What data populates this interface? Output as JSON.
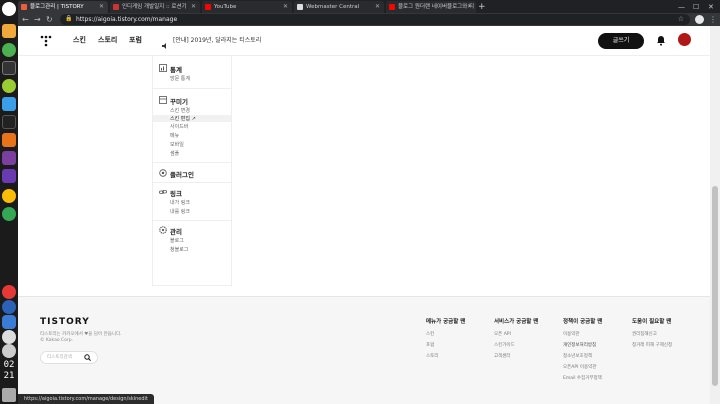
{
  "os": {
    "clock_hour": "02",
    "clock_minute": "21"
  },
  "browser": {
    "tabs": [
      {
        "label": "블로그관리 | TISTORY",
        "favicon_color": "#f25c3a"
      },
      {
        "label": "인디게임 개발일지 :: 로션기",
        "favicon_color": "#cc3333"
      },
      {
        "label": "YouTube",
        "favicon_color": "#ff0000"
      },
      {
        "label": "Webmaster Central",
        "favicon_color": "#dddddd"
      },
      {
        "label": "블로그 원더랜 네이버블로그와 티",
        "favicon_color": "#ff0000"
      }
    ],
    "url": "https://aigoia.tistory.com/manage",
    "status_url": "https://aigoia.tistory.com/manage/design/skinedit"
  },
  "header": {
    "nav": [
      "스킨",
      "스토리",
      "포럼"
    ],
    "notice": "[안내] 2019년, 달라지는 티스토리",
    "write_label": "글쓰기"
  },
  "sidemenu": {
    "sections": [
      {
        "title": "통계",
        "icon": "chart-icon",
        "items": [
          "방문 통계"
        ]
      },
      {
        "title": "꾸미기",
        "icon": "decorate-icon",
        "items": [
          "스킨 변경",
          "스킨 편집 ↗",
          "사이드바",
          "메뉴",
          "모바일",
          "샘플"
        ]
      },
      {
        "title": "플러그인",
        "icon": "plugin-icon",
        "items": []
      },
      {
        "title": "링크",
        "icon": "link-icon",
        "items": [
          "내가 링크",
          "내를 링크"
        ]
      },
      {
        "title": "관리",
        "icon": "gear-icon",
        "items": [
          "블로그",
          "청블로그"
        ]
      }
    ]
  },
  "footer": {
    "logo": "TISTORY",
    "desc": "티스토리는 카카오에서 ♥을 담아 만듭니다.",
    "corp": "© Kakao Corp.",
    "search_placeholder": "티스토리검색",
    "columns": [
      {
        "title": "메뉴가 궁금할 땐",
        "links": [
          "스킨",
          "포럼",
          "스토리"
        ]
      },
      {
        "title": "서비스가 궁금할 땐",
        "links": [
          "오픈 API",
          "스킨가이드",
          "고객센터"
        ]
      },
      {
        "title": "정책이 궁금할 땐",
        "links": [
          "이용약관",
          "개인정보처리방침",
          "청소년보호정책",
          "오픈API 이용약관",
          "Email 수집거부정책"
        ]
      },
      {
        "title": "도움이 필요할 땐",
        "links": [
          "권리침해신고",
          "청거래 피해 구제신청"
        ]
      }
    ]
  }
}
